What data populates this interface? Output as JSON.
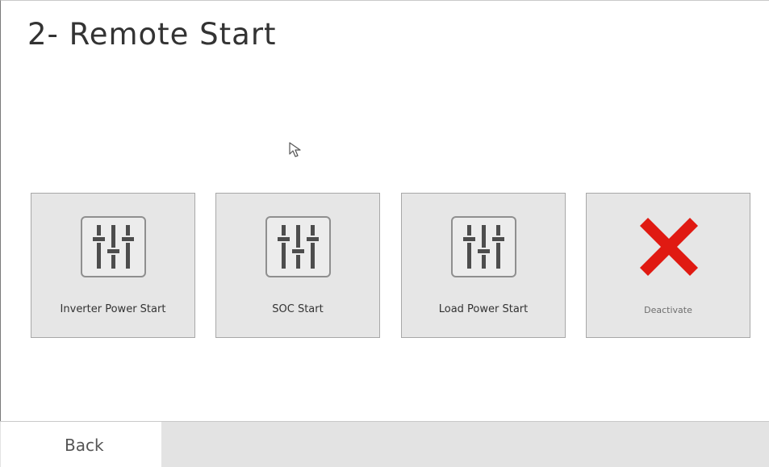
{
  "header": {
    "title": "2- Remote Start"
  },
  "tiles": [
    {
      "label": "Inverter Power Start",
      "icon": "sliders-icon"
    },
    {
      "label": "SOC Start",
      "icon": "sliders-icon"
    },
    {
      "label": "Load Power Start",
      "icon": "sliders-icon"
    },
    {
      "label": "Deactivate",
      "icon": "red-x-icon"
    }
  ],
  "footer": {
    "back_label": "Back"
  },
  "colors": {
    "tile_bg": "#e6e6e6",
    "deactivate_red": "#e01a12",
    "icon_gray": "#4d4d4d",
    "footer_bg": "#e3e3e3"
  }
}
